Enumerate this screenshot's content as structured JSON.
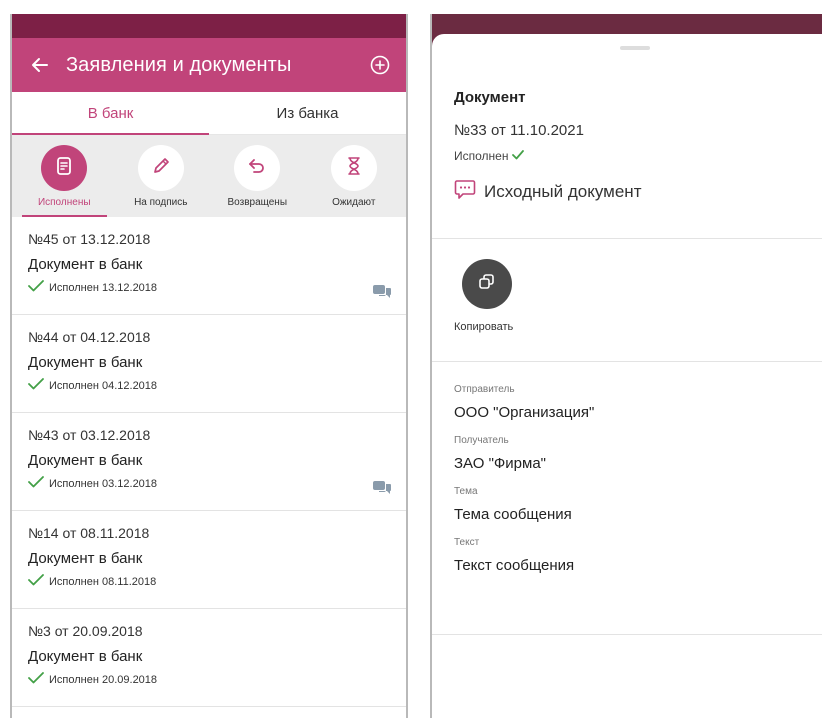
{
  "left": {
    "header": {
      "title": "Заявления и документы",
      "back_icon": "arrow-left-icon",
      "add_icon": "plus-circle-icon"
    },
    "tabs": [
      {
        "label": "В банк",
        "active": true
      },
      {
        "label": "Из банка",
        "active": false
      }
    ],
    "filters": [
      {
        "label": "Исполнены",
        "icon": "document-icon",
        "active": true
      },
      {
        "label": "На подпись",
        "icon": "pencil-icon",
        "active": false
      },
      {
        "label": "Возвращены",
        "icon": "return-arrow-icon",
        "active": false
      },
      {
        "label": "Ожидают",
        "icon": "hourglass-icon",
        "active": false
      }
    ],
    "documents": [
      {
        "number": "№45 от 13.12.2018",
        "name": "Документ в банк",
        "status": "Исполнен 13.12.2018",
        "has_chat": true
      },
      {
        "number": "№44 от 04.12.2018",
        "name": "Документ в банк",
        "status": "Исполнен 04.12.2018",
        "has_chat": false
      },
      {
        "number": "№43 от 03.12.2018",
        "name": "Документ в банк",
        "status": "Исполнен 03.12.2018",
        "has_chat": true
      },
      {
        "number": "№14 от 08.11.2018",
        "name": "Документ в банк",
        "status": "Исполнен 08.11.2018",
        "has_chat": false
      },
      {
        "number": "№3 от 20.09.2018",
        "name": "Документ в банк",
        "status": "Исполнен 20.09.2018",
        "has_chat": false
      }
    ]
  },
  "right": {
    "heading": "Документ",
    "number": "№33 от 11.10.2021",
    "status": "Исполнен",
    "source_doc": "Исходный документ",
    "copy_label": "Копировать",
    "fields": [
      {
        "label": "Отправитель",
        "value": "ООО \"Организация\""
      },
      {
        "label": "Получатель",
        "value": "ЗАО \"Фирма\""
      },
      {
        "label": "Тема",
        "value": "Тема сообщения"
      },
      {
        "label": "Текст",
        "value": "Текст сообщения"
      }
    ]
  },
  "colors": {
    "accent": "#c1447a",
    "status_bar": "#7d2046",
    "check": "#43a047"
  }
}
